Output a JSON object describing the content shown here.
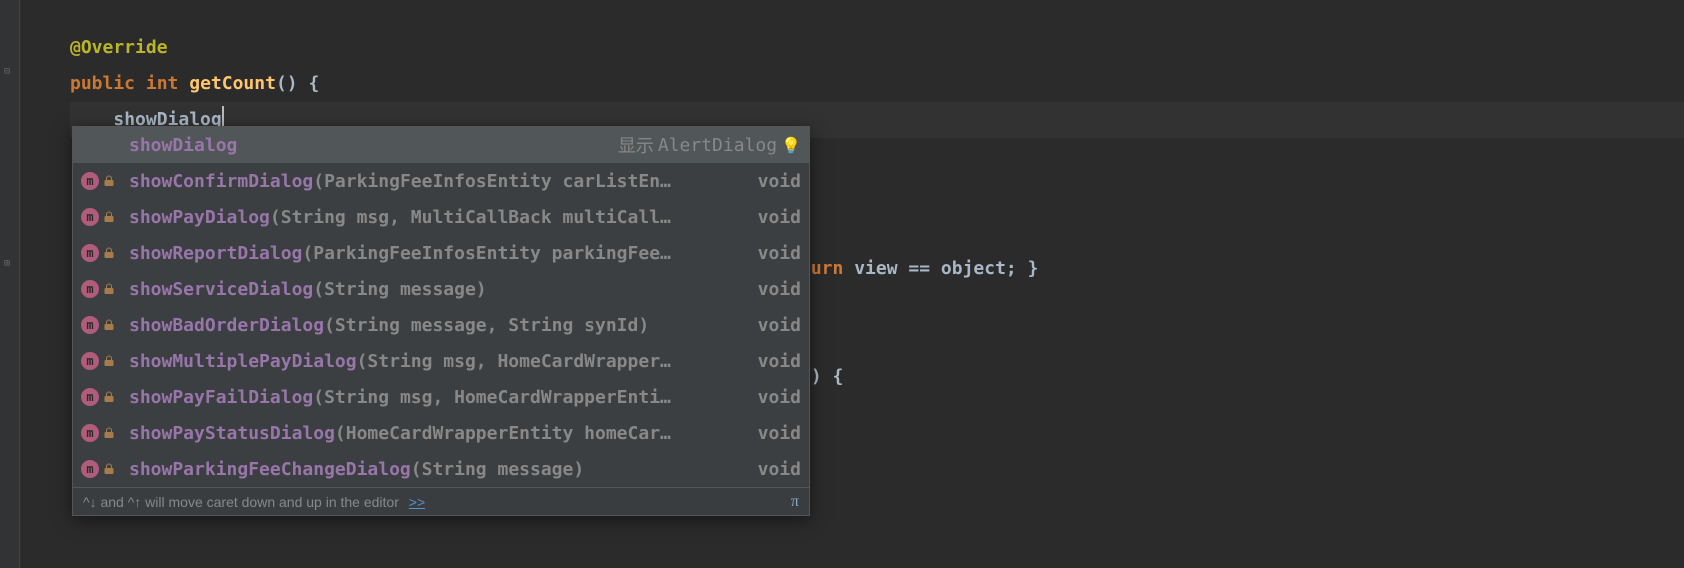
{
  "code": {
    "override": "@Override",
    "public": "public",
    "int": "int",
    "getCount": "getCount",
    "parens": "()",
    "brace_open": " {",
    "typed": "showDialog",
    "return_kw": "turn",
    "view_eq": " view == object; }",
    "paren_brace": "n) {"
  },
  "popup": {
    "selected": {
      "name": "showDialog",
      "hint_prefix": "显示",
      "hint_rest": "AlertDialog"
    },
    "items": [
      {
        "prefix": "showConfirm",
        "bold": "Dialog",
        "params": "(ParkingFeeInfosEntity carListEn…",
        "ret": "void"
      },
      {
        "prefix": "showPay",
        "bold": "Dialog",
        "params": "(String msg, MultiCallBack multiCall…",
        "ret": "void"
      },
      {
        "prefix": "showReport",
        "bold": "Dialog",
        "params": "(ParkingFeeInfosEntity parkingFee…",
        "ret": "void"
      },
      {
        "prefix": "showService",
        "bold": "Dialog",
        "params": "(String message)",
        "ret": "void"
      },
      {
        "prefix": "showBadOrder",
        "bold": "Dialog",
        "params": "(String message, String synId)",
        "ret": "void"
      },
      {
        "prefix": "showMultiplePay",
        "bold": "Dialog",
        "params": "(String msg, HomeCardWrapper…",
        "ret": "void"
      },
      {
        "prefix": "showPayFail",
        "bold": "Dialog",
        "params": "(String msg, HomeCardWrapperEnti…",
        "ret": "void"
      },
      {
        "prefix": "showPayStatus",
        "bold": "Dialog",
        "params": "(HomeCardWrapperEntity homeCar…",
        "ret": "void"
      },
      {
        "prefix": "showParkingFeeChange",
        "bold": "Dialog",
        "params": "(String message)",
        "ret": "void"
      }
    ],
    "footer_text": "^↓ and ^↑ will move caret down and up in the editor",
    "footer_link": ">>",
    "pi": "π"
  }
}
